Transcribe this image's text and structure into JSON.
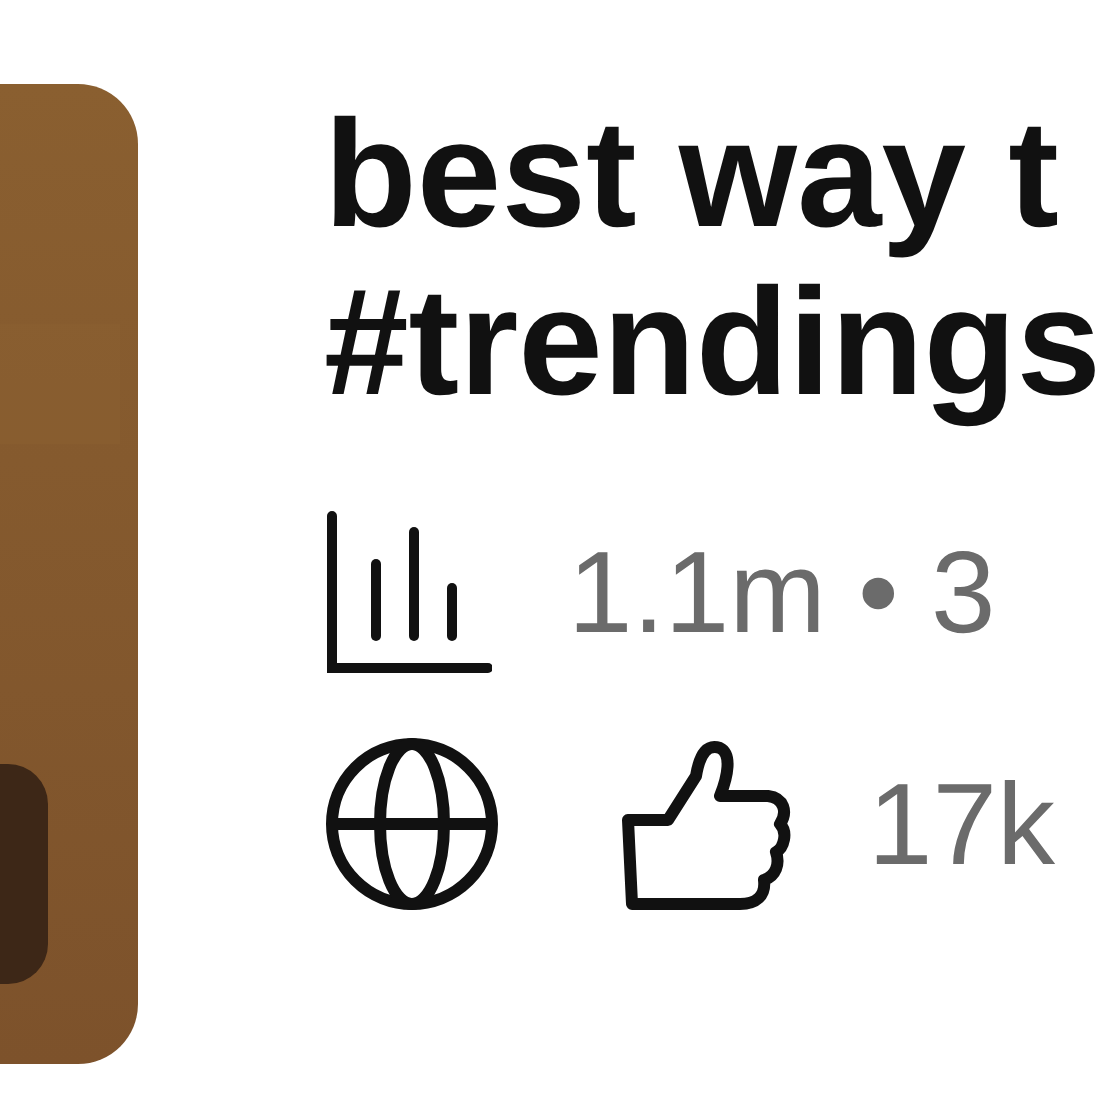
{
  "video": {
    "title_lines": [
      "best way t",
      "#trendings"
    ],
    "stats": "1.1m • 3",
    "likes": "17k"
  }
}
